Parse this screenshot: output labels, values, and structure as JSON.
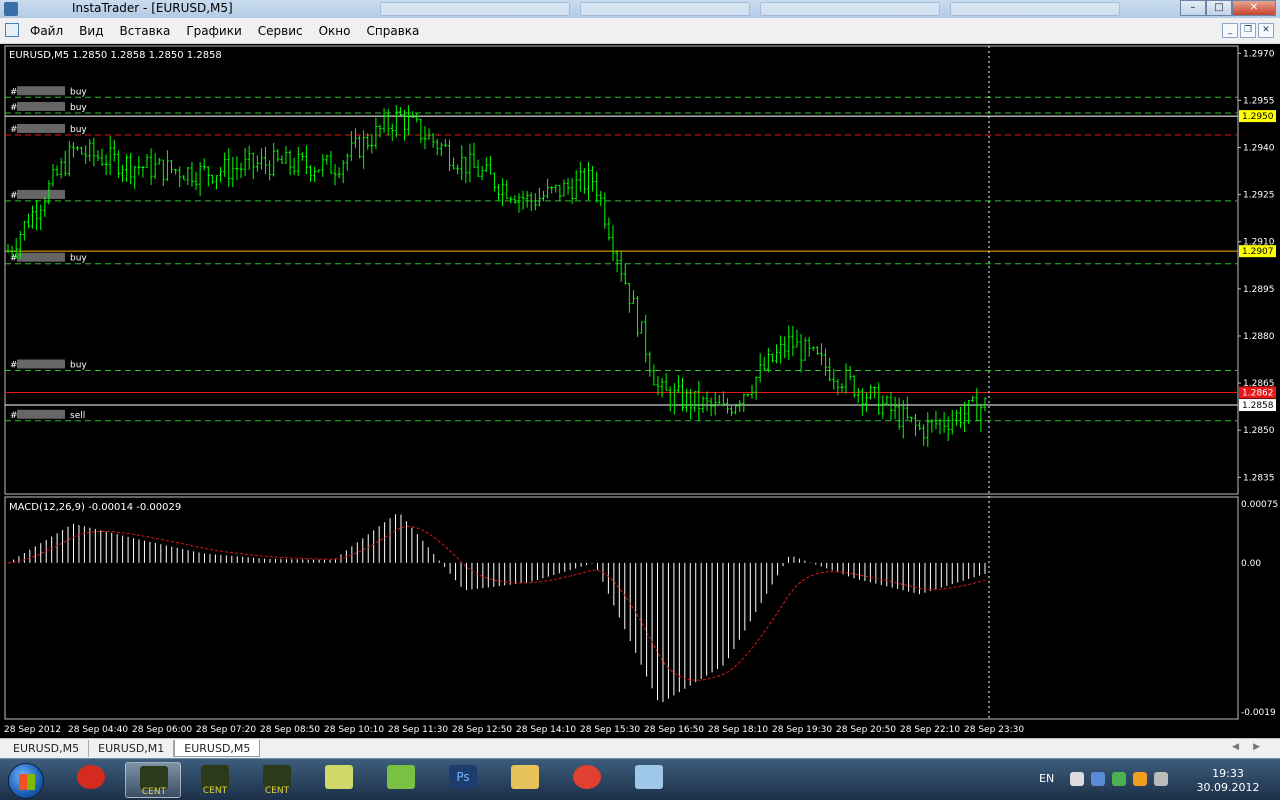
{
  "window": {
    "title": "InstaTrader - [EURUSD,M5]"
  },
  "menu": {
    "items": [
      "Файл",
      "Вид",
      "Вставка",
      "Графики",
      "Сервис",
      "Окно",
      "Справка"
    ]
  },
  "chart": {
    "header": "EURUSD,M5  1.2850 1.2858 1.2850 1.2858",
    "price_scale": [
      "1.2970",
      "1.2955",
      "1.2940",
      "1.2925",
      "1.2910",
      "1.2895",
      "1.2880",
      "1.2865",
      "1.2850",
      "1.2835"
    ],
    "price_tags": [
      {
        "price": 1.295,
        "label": "1.2950",
        "bg": "#ffff00",
        "fg": "#000000"
      },
      {
        "price": 1.2907,
        "label": "1.2907",
        "bg": "#ffff00",
        "fg": "#000000"
      },
      {
        "price": 1.2862,
        "label": "1.2862",
        "bg": "#e81818",
        "fg": "#ffffff"
      },
      {
        "price": 1.2858,
        "label": "1.2858",
        "bg": "#ffffff",
        "fg": "#000000"
      }
    ],
    "orders": [
      {
        "price": 1.2956,
        "label": "#",
        "type": "buy",
        "line_color": "#2fbf2f"
      },
      {
        "price": 1.2951,
        "label": "#",
        "type": "buy",
        "line_color": "#2fbf2f"
      },
      {
        "price": 1.2944,
        "label": "#",
        "type": "buy",
        "line_color": "#e01818"
      },
      {
        "price": 1.2923,
        "label": "#",
        "type": "",
        "line_color": "#2fbf2f"
      },
      {
        "price": 1.2903,
        "label": "#",
        "type": "buy",
        "line_color": "#2fbf2f"
      },
      {
        "price": 1.2869,
        "label": "#",
        "type": "buy",
        "line_color": "#2fbf2f"
      },
      {
        "price": 1.2853,
        "label": "#",
        "type": "sell",
        "line_color": "#2fbf2f"
      }
    ],
    "levels": [
      {
        "price": 1.295,
        "color": "#ffffff"
      },
      {
        "price": 1.2907,
        "color": "#ffb000"
      },
      {
        "price": 1.2862,
        "color": "#e81818"
      },
      {
        "price": 1.2858,
        "color": "#ffffff"
      }
    ],
    "macd": {
      "label": "MACD(12,26,9) -0.00014 -0.00029",
      "scale": [
        "0.00075",
        "0.00",
        "-0.0019"
      ]
    },
    "time_axis": [
      "28 Sep 2012",
      "28 Sep 04:40",
      "28 Sep 06:00",
      "28 Sep 07:20",
      "28 Sep 08:50",
      "28 Sep 10:10",
      "28 Sep 11:30",
      "28 Sep 12:50",
      "28 Sep 14:10",
      "28 Sep 15:30",
      "28 Sep 16:50",
      "28 Sep 18:10",
      "28 Sep 19:30",
      "28 Sep 20:50",
      "28 Sep 22:10",
      "28 Sep 23:30"
    ],
    "colors": {
      "candle": "#00ff00",
      "background": "#000000",
      "grid_text": "#ffffff",
      "macd_hist": "#ffffff",
      "macd_signal": "#e01818"
    }
  },
  "chart_data": {
    "type": "line",
    "title": "EURUSD,M5",
    "xlabel": "",
    "ylabel": "",
    "ylim": [
      1.283,
      1.2972
    ],
    "x": [
      "28 Sep 2012",
      "28 Sep 04:40",
      "28 Sep 06:00",
      "28 Sep 07:20",
      "28 Sep 08:50",
      "28 Sep 10:10",
      "28 Sep 11:30",
      "28 Sep 12:50",
      "28 Sep 14:10",
      "28 Sep 15:30",
      "28 Sep 16:50",
      "28 Sep 18:10",
      "28 Sep 19:30",
      "28 Sep 20:50",
      "28 Sep 22:10",
      "28 Sep 23:30"
    ],
    "series": [
      {
        "name": "EURUSD",
        "values": [
          1.2907,
          1.2939,
          1.2934,
          1.2932,
          1.2935,
          1.2934,
          1.295,
          1.2935,
          1.2923,
          1.293,
          1.2862,
          1.2856,
          1.2878,
          1.2864,
          1.285,
          1.2858
        ]
      },
      {
        "name": "MACD",
        "values": [
          0.0,
          0.0005,
          0.0003,
          0.00012,
          5e-05,
          4e-05,
          0.00065,
          -0.00035,
          -0.00025,
          0.0,
          -0.0018,
          -0.0013,
          0.0001,
          -0.0002,
          -0.0004,
          -0.00014
        ]
      }
    ],
    "grid": false,
    "legend": "none"
  },
  "tabs": [
    "EURUSD,M5",
    "EURUSD,M1",
    "EURUSD,M5"
  ],
  "active_tab": 2,
  "taskbar": {
    "items": [
      {
        "name": "app-red",
        "label": ""
      },
      {
        "name": "cent-1",
        "label": "CENT"
      },
      {
        "name": "cent-2",
        "label": "CENT"
      },
      {
        "name": "cent-3",
        "label": "CENT"
      },
      {
        "name": "notepad",
        "label": ""
      },
      {
        "name": "pen",
        "label": ""
      },
      {
        "name": "photoshop",
        "label": "Ps"
      },
      {
        "name": "explorer",
        "label": ""
      },
      {
        "name": "chrome",
        "label": ""
      },
      {
        "name": "window",
        "label": ""
      }
    ],
    "lang": "EN",
    "time": "19:33",
    "date": "30.09.2012"
  }
}
